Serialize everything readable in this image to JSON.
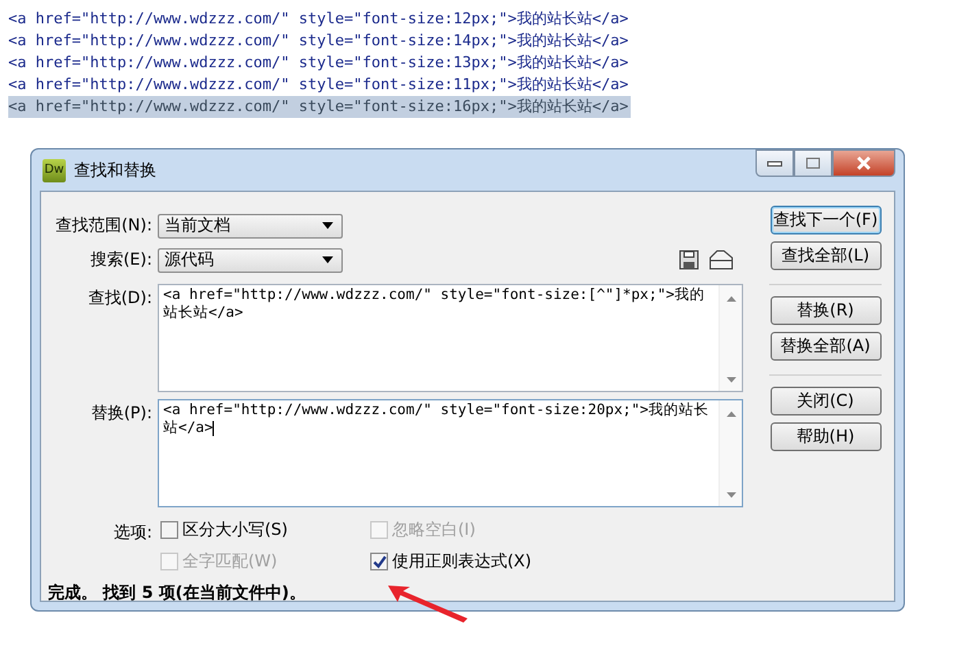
{
  "code_lines": [
    {
      "text": "<a href=\"http://www.wdzzz.com/\" style=\"font-size:12px;\">我的站长站</a>",
      "selected": false
    },
    {
      "text": "<a href=\"http://www.wdzzz.com/\" style=\"font-size:14px;\">我的站长站</a>",
      "selected": false
    },
    {
      "text": "<a href=\"http://www.wdzzz.com/\" style=\"font-size:13px;\">我的站长站</a>",
      "selected": false
    },
    {
      "text": "<a href=\"http://www.wdzzz.com/\" style=\"font-size:11px;\">我的站长站</a>",
      "selected": false
    },
    {
      "text": "<a href=\"http://www.wdzzz.com/\" style=\"font-size:16px;\">我的站长站</a>",
      "selected": true
    }
  ],
  "dialog": {
    "app_badge": "Dw",
    "title": "查找和替换",
    "scope": {
      "label": "查找范围(N):",
      "value": "当前文档"
    },
    "search": {
      "label": "搜索(E):",
      "value": "源代码"
    },
    "find": {
      "label": "查找(D):",
      "value": "<a href=\"http://www.wdzzz.com/\" style=\"font-size:[^\"]*px;\">我的站长站</a>"
    },
    "replace": {
      "label": "替换(P):",
      "value": "<a href=\"http://www.wdzzz.com/\" style=\"font-size:20px;\">我的站长站</a>"
    },
    "options_label": "选项:",
    "options": [
      {
        "label": "区分大小写(S)",
        "checked": false,
        "disabled": false
      },
      {
        "label": "忽略空白(I)",
        "checked": false,
        "disabled": true
      },
      {
        "label": "全字匹配(W)",
        "checked": false,
        "disabled": true
      },
      {
        "label": "使用正则表达式(X)",
        "checked": true,
        "disabled": false
      }
    ],
    "buttons": [
      {
        "label": "查找下一个(F)",
        "default": true
      },
      {
        "label": "查找全部(L)",
        "default": false
      },
      {
        "label": "替换(R)",
        "default": false
      },
      {
        "label": "替换全部(A)",
        "default": false
      },
      {
        "label": "关闭(C)",
        "default": false
      },
      {
        "label": "帮助(H)",
        "default": false
      }
    ],
    "status": "完成。 找到 5 项(在当前文件中)。"
  }
}
